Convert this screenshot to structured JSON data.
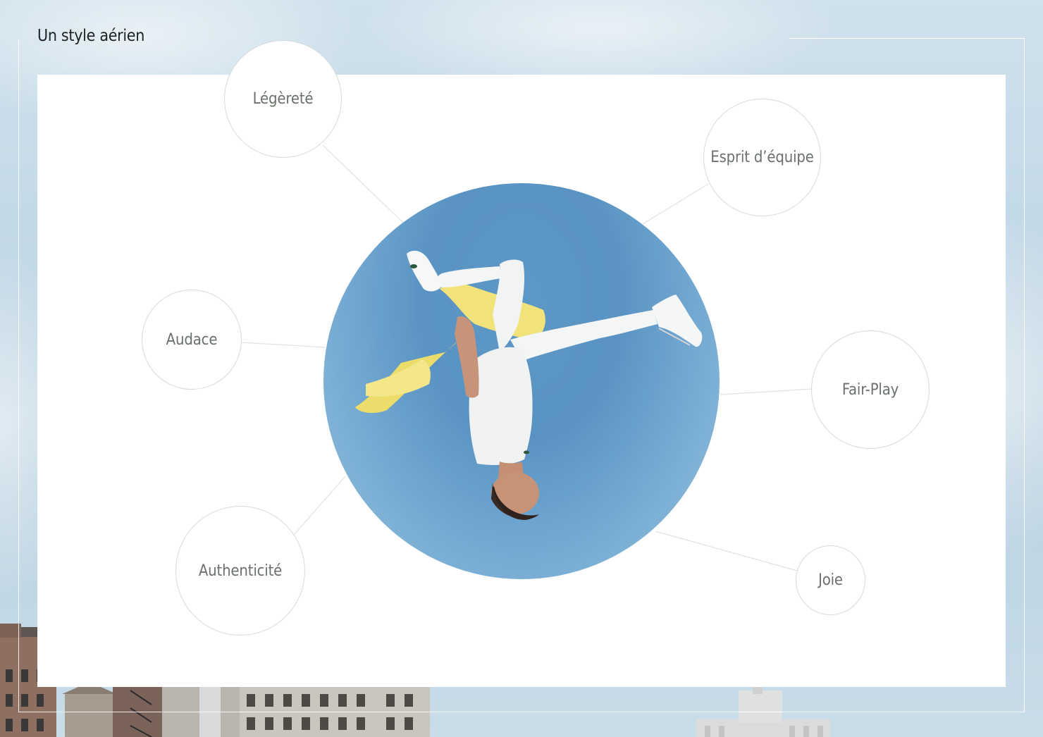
{
  "header": {
    "title": "Un style aérien"
  },
  "hero": {
    "image": "man-backflip-photo"
  },
  "values": [
    {
      "label": "Légèreté"
    },
    {
      "label": "Esprit d’équipe"
    },
    {
      "label": "Audace"
    },
    {
      "label": "Fair-Play"
    },
    {
      "label": "Authenticité"
    },
    {
      "label": "Joie"
    }
  ],
  "colors": {
    "sky": "#c4d9e7",
    "panel": "#ffffff",
    "bubble_border": "#d7d9d9",
    "label_text": "#6b716b",
    "title_text": "#1e2226",
    "hero_sky": "#5a93c3",
    "shirt_yellow": "#f1e27a"
  }
}
